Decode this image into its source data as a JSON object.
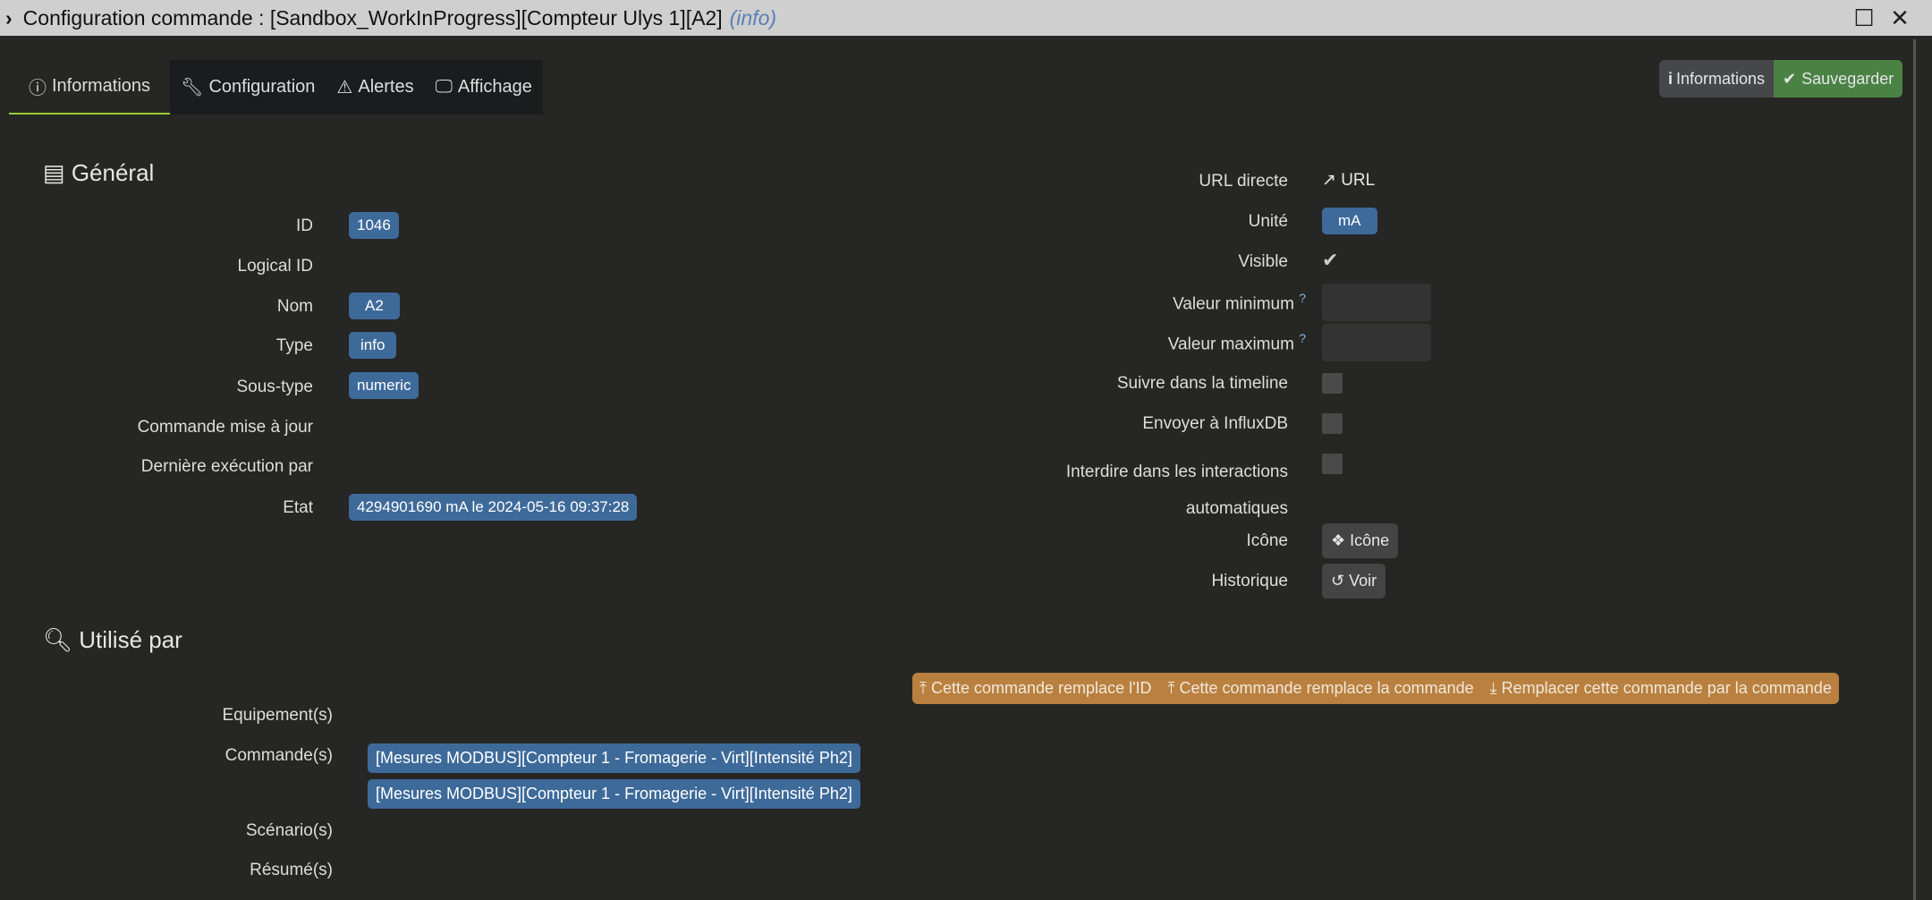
{
  "window": {
    "title": "Configuration commande : [Sandbox_WorkInProgress][Compteur Ulys 1][A2]",
    "type_tag": "(info)"
  },
  "tabs": [
    {
      "label": "Informations",
      "icon": "info-circle-icon"
    },
    {
      "label": "Configuration",
      "icon": "wrench-icon"
    },
    {
      "label": "Alertes",
      "icon": "warning-icon"
    },
    {
      "label": "Affichage",
      "icon": "monitor-icon"
    }
  ],
  "actions": {
    "info_label": "Informations",
    "save_label": "Sauvegarder"
  },
  "general": {
    "heading": "Général",
    "rows": [
      {
        "label": "ID",
        "value": "1046"
      },
      {
        "label": "Logical ID",
        "value": null
      },
      {
        "label": "Nom",
        "value": "A2"
      },
      {
        "label": "Type",
        "value": "info"
      },
      {
        "label": "Sous-type",
        "value": "numeric"
      },
      {
        "label": "Commande mise à jour",
        "value": null
      },
      {
        "label": "Dernière exécution par",
        "value": null
      },
      {
        "label": "Etat",
        "value": "4294901690 mA le 2024-05-16 09:37:28"
      }
    ],
    "right": {
      "url_label": "URL directe",
      "url_link": "URL",
      "unit_label": "Unité",
      "unit": "mA",
      "visible_label": "Visible",
      "visible": true,
      "min_label": "Valeur minimum",
      "min_value": "",
      "max_label": "Valeur maximum",
      "max_value": "",
      "timeline_label": "Suivre dans la timeline",
      "timeline": false,
      "influx_label": "Envoyer à InfluxDB",
      "influx": false,
      "interact_label_1": "Interdire dans les interactions",
      "interact_label_2": "automatiques",
      "interact": false,
      "icon_label": "Icône",
      "icon_button": "Icône",
      "history_label": "Historique",
      "history_button": "Voir"
    }
  },
  "used_by": {
    "heading": "Utilisé par",
    "actions": [
      "Cette commande remplace l'ID",
      "Cette commande remplace la commande",
      "Remplacer cette commande par la commande"
    ],
    "equipment_label": "Equipement(s)",
    "commands_label": "Commande(s)",
    "commands": [
      "[Mesures MODBUS][Compteur 1 - Fromagerie - Virt][Intensité Ph2]",
      "[Mesures MODBUS][Compteur 1 - Fromagerie - Virt][Intensité Ph2]"
    ],
    "scenarios_label": "Scénario(s)",
    "summaries_label": "Résumé(s)"
  }
}
